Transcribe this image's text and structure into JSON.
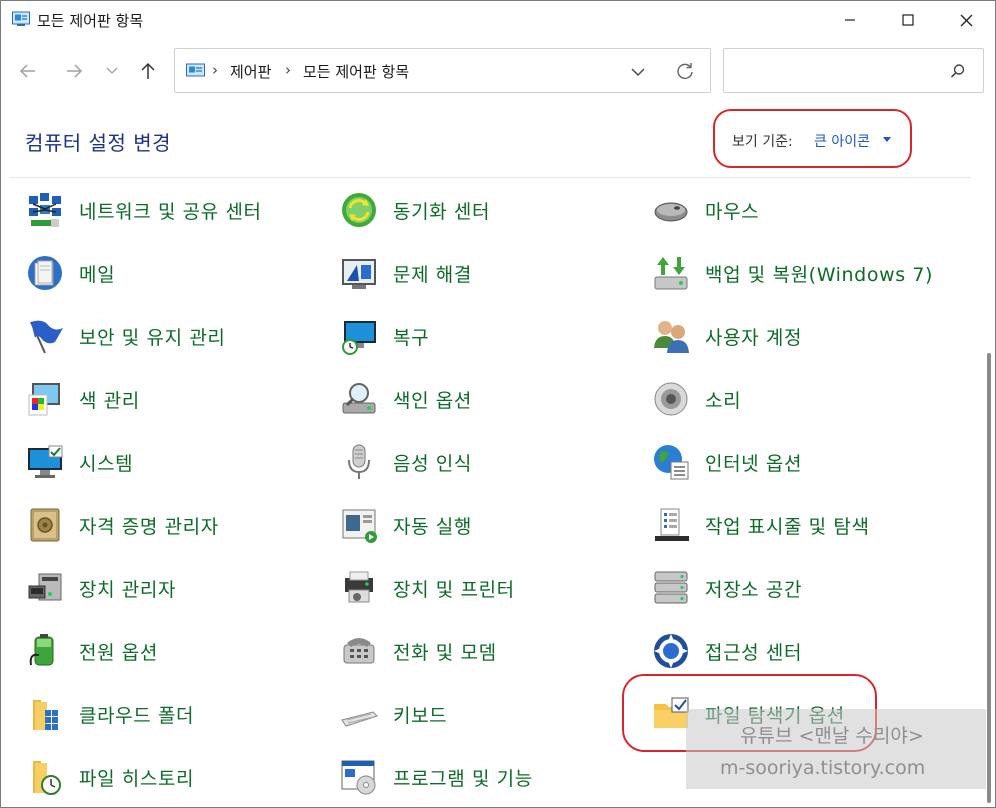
{
  "window": {
    "title": "모든 제어판 항목",
    "minimize_label": "",
    "maximize_label": "",
    "close_label": ""
  },
  "nav": {
    "breadcrumbs": [
      "제어판",
      "모든 제어판 항목"
    ],
    "search_placeholder": ""
  },
  "header": {
    "title": "컴퓨터 설정 변경",
    "view_by_label": "보기 기준:",
    "view_by_value": "큰 아이콘"
  },
  "items": {
    "col1": [
      {
        "label": "네트워크 및 공유 센터",
        "icon": "network-sharing-icon"
      },
      {
        "label": "메일",
        "icon": "mail-icon"
      },
      {
        "label": "보안 및 유지 관리",
        "icon": "security-flag-icon"
      },
      {
        "label": "색 관리",
        "icon": "color-management-icon"
      },
      {
        "label": "시스템",
        "icon": "system-monitor-icon"
      },
      {
        "label": "자격 증명 관리자",
        "icon": "credential-vault-icon"
      },
      {
        "label": "장치 관리자",
        "icon": "device-manager-icon"
      },
      {
        "label": "전원 옵션",
        "icon": "power-battery-icon"
      },
      {
        "label": "클라우드 폴더",
        "icon": "cloud-folder-icon"
      },
      {
        "label": "파일 히스토리",
        "icon": "file-history-icon"
      }
    ],
    "col2": [
      {
        "label": "동기화 센터",
        "icon": "sync-center-icon"
      },
      {
        "label": "문제 해결",
        "icon": "troubleshoot-icon"
      },
      {
        "label": "복구",
        "icon": "recovery-icon"
      },
      {
        "label": "색인 옵션",
        "icon": "indexing-icon"
      },
      {
        "label": "음성 인식",
        "icon": "microphone-icon"
      },
      {
        "label": "자동 실행",
        "icon": "autoplay-icon"
      },
      {
        "label": "장치 및 프린터",
        "icon": "printer-icon"
      },
      {
        "label": "전화 및 모뎀",
        "icon": "phone-modem-icon"
      },
      {
        "label": "키보드",
        "icon": "keyboard-icon"
      },
      {
        "label": "프로그램 및 기능",
        "icon": "programs-features-icon"
      }
    ],
    "col3": [
      {
        "label": "마우스",
        "icon": "mouse-icon"
      },
      {
        "label": "백업 및 복원(Windows 7)",
        "icon": "backup-restore-icon"
      },
      {
        "label": "사용자 계정",
        "icon": "user-accounts-icon"
      },
      {
        "label": "소리",
        "icon": "speaker-icon"
      },
      {
        "label": "인터넷 옵션",
        "icon": "internet-options-icon"
      },
      {
        "label": "작업 표시줄 및 탐색",
        "icon": "taskbar-icon"
      },
      {
        "label": "저장소 공간",
        "icon": "storage-spaces-icon"
      },
      {
        "label": "접근성 센터",
        "icon": "ease-of-access-icon"
      },
      {
        "label": "파일 탐색기 옵션",
        "icon": "file-explorer-options-icon"
      }
    ]
  },
  "watermark": {
    "line1": "유튜브 <맨날 수리야>",
    "line2": "m-sooriya.tistory.com"
  },
  "colors": {
    "link_green": "#0d6b2a",
    "title_blue": "#1e3287",
    "accent_blue": "#1a55c0",
    "highlight_red": "#d9262c"
  }
}
